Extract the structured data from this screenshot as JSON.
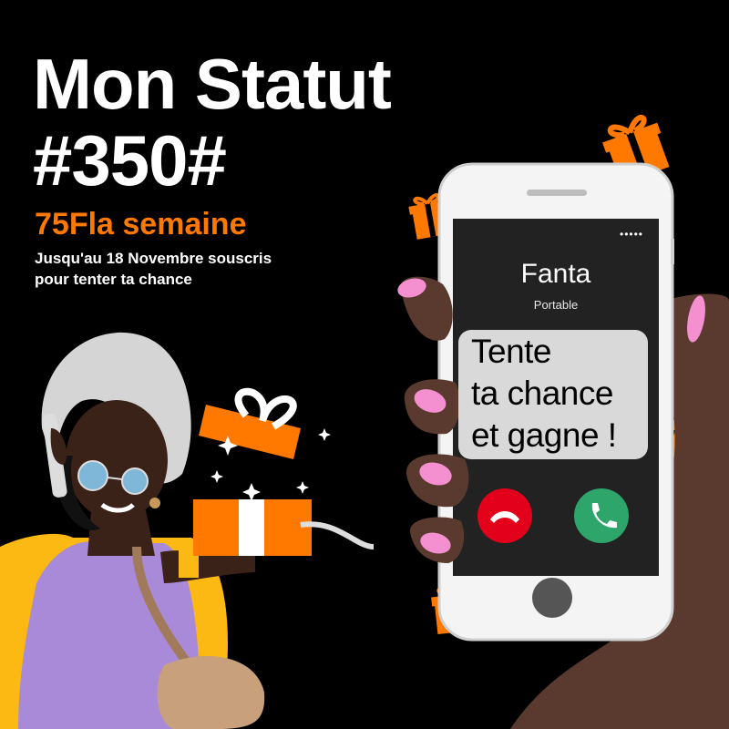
{
  "headline": {
    "line1": "Mon Statut",
    "line2": "#350#"
  },
  "price": "75Fla semaine",
  "promo": {
    "line1": "Jusqu'au 18 Novembre souscris",
    "line2": "pour tenter ta chance"
  },
  "phone": {
    "contact_name": "Fanta",
    "contact_type": "Portable",
    "status_dots": "•••••",
    "message": {
      "line1": "Tente",
      "line2": "ta chance",
      "line3": "et gagne !"
    },
    "decline_icon": "phone-hangup-icon",
    "accept_icon": "phone-answer-icon"
  },
  "colors": {
    "background": "#000000",
    "accent": "#ff7900",
    "decline": "#e3001b",
    "accept": "#2ea56b",
    "skin": "#5a3a2e",
    "nails": "#f48fd0"
  }
}
